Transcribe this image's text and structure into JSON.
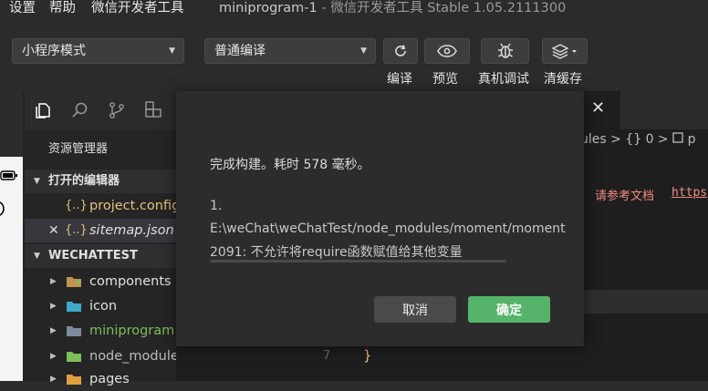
{
  "menu": [
    "设置",
    "帮助",
    "微信开发者工具"
  ],
  "window": {
    "project": "miniprogram-1",
    "separator": " - ",
    "app": "微信开发者工具 Stable 1.05.2111300"
  },
  "toolbar": {
    "mode_select": "小程序模式",
    "compile_select": "普通编译",
    "buttons": [
      {
        "label": "编译",
        "icon": "refresh-icon"
      },
      {
        "label": "预览",
        "icon": "eye-icon"
      },
      {
        "label": "真机调试",
        "icon": "bug-icon"
      },
      {
        "label": "清缓存",
        "icon": "layers-icon"
      }
    ]
  },
  "explorer": {
    "title": "资源管理器",
    "open_editors": {
      "header": "打开的编辑器",
      "files": [
        {
          "name": "project.config",
          "icon_text": "{..}"
        },
        {
          "name": "sitemap.json",
          "icon_text": "{..}",
          "close": "✕"
        }
      ]
    },
    "workspace": {
      "header": "WECHATTEST",
      "items": [
        {
          "name": "components",
          "color": "#e0e0e0"
        },
        {
          "name": "icon",
          "color": "#e0e0e0"
        },
        {
          "name": "miniprogram",
          "color": "#7cbf5a"
        },
        {
          "name": "node_modules",
          "color": "#bdbdbd"
        },
        {
          "name": "pages",
          "color": "#e0e0e0"
        }
      ]
    }
  },
  "editor": {
    "tab_close": "✕",
    "breadcrumb": "ules > {} 0 > ",
    "breadcrumb_tail": "p",
    "warning_text": "请参考文档",
    "warning_link": "https",
    "line_number": "7",
    "code_char": "}"
  },
  "modal": {
    "message": "完成构建。耗时 578 毫秒。",
    "details": [
      "1.",
      "E:\\weChat\\weChatTest/node_modules/moment/moment",
      "2091: 不允许将require函数赋值给其他变量"
    ],
    "cancel": "取消",
    "confirm": "确定"
  }
}
